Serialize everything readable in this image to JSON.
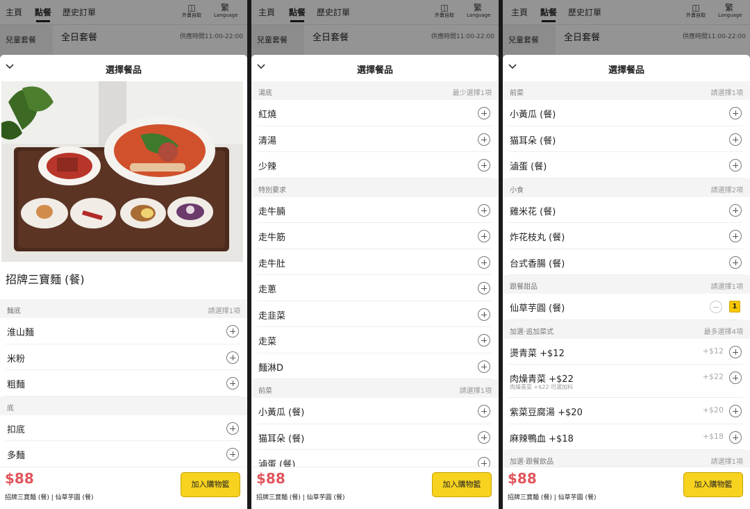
{
  "nav": {
    "tabs": [
      "主頁",
      "點餐",
      "歷史訂單"
    ],
    "takeaway_icon": "外賣自取",
    "lang_icon_glyph": "繁",
    "lang_label": "Language"
  },
  "bg": {
    "category": "兒童套餐",
    "section_title": "全日套餐",
    "hours": "供應時間11:00-22:00"
  },
  "sheet": {
    "title": "選擇餐品"
  },
  "footer": {
    "price": "$88",
    "summary": "招牌三寶麵 (餐) | 仙草芋圓 (餐)",
    "add_button": "加入購物籃"
  },
  "screen1": {
    "dish_name": "招牌三寶麵 (餐)",
    "groups": [
      {
        "title": "麵底",
        "rule": "請選擇1項",
        "items": [
          {
            "name": "淮山麵"
          },
          {
            "name": "米粉"
          },
          {
            "name": "粗麵"
          }
        ]
      },
      {
        "title": "底",
        "rule": "",
        "items": [
          {
            "name": "扣底"
          },
          {
            "name": "多麵"
          }
        ]
      }
    ]
  },
  "screen2": {
    "groups": [
      {
        "title": "湯底",
        "rule": "最少選擇1項",
        "items": [
          {
            "name": "紅燒"
          },
          {
            "name": "清湯"
          },
          {
            "name": "少辣"
          }
        ]
      },
      {
        "title": "特別要求",
        "rule": "",
        "items": [
          {
            "name": "走牛腩"
          },
          {
            "name": "走牛筋"
          },
          {
            "name": "走牛肚"
          },
          {
            "name": "走蔥"
          },
          {
            "name": "走韭菜"
          },
          {
            "name": "走菜"
          },
          {
            "name": "麵淋D"
          }
        ]
      },
      {
        "title": "前菜",
        "rule": "請選擇1項",
        "items": [
          {
            "name": "小黃瓜 (餐)"
          },
          {
            "name": "猫耳朵 (餐)"
          },
          {
            "name": "滷蛋 (餐)"
          }
        ]
      }
    ]
  },
  "screen3": {
    "groups": [
      {
        "title": "前菜",
        "rule": "請選擇1項",
        "items": [
          {
            "name": "小黃瓜 (餐)"
          },
          {
            "name": "猫耳朵 (餐)"
          },
          {
            "name": "滷蛋 (餐)"
          }
        ]
      },
      {
        "title": "小食",
        "rule": "請選擇2項",
        "items": [
          {
            "name": "雞米花 (餐)"
          },
          {
            "name": "炸花枝丸 (餐)"
          },
          {
            "name": "台式香腸 (餐)"
          }
        ]
      },
      {
        "title": "跟餐甜品",
        "rule": "請選擇1項",
        "items": [
          {
            "name": "仙草芋圓 (餐)",
            "qty": "1"
          }
        ]
      },
      {
        "title": "加選·追加菜式",
        "rule": "最多選擇4項",
        "items": [
          {
            "name": "燙青菜 +$12",
            "price": "+$12"
          },
          {
            "name": "肉燥青菜 +$22",
            "price": "+$22",
            "note": "肉燥青菜 +$22·可選加料"
          },
          {
            "name": "紫菜豆腐湯 +$20",
            "price": "+$20"
          },
          {
            "name": "麻辣鴨血 +$18",
            "price": "+$18"
          }
        ]
      },
      {
        "title": "加選·跟餐飲品",
        "rule": "請選擇1項",
        "items": []
      }
    ]
  }
}
